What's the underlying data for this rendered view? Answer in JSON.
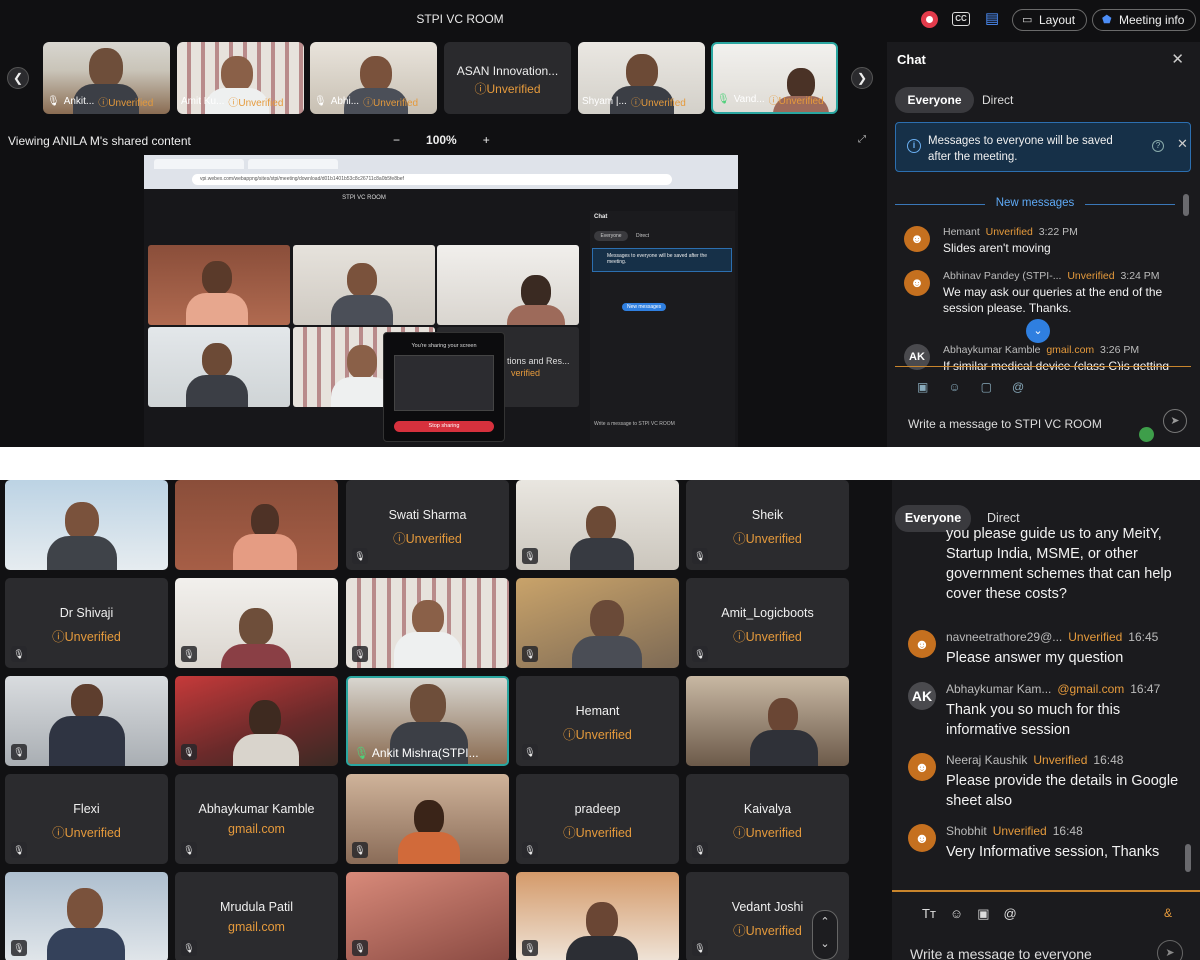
{
  "top": {
    "room_title": "STPI VC ROOM",
    "header": {
      "layout_label": "Layout",
      "meeting_info_label": "Meeting info"
    },
    "strip": [
      {
        "name": "Ankit...",
        "status": "Unverified"
      },
      {
        "name": "Amit Ku...",
        "status": "Unverified"
      },
      {
        "name": "Abhi...",
        "status": "Unverified"
      },
      {
        "name": "ASAN Innovation...",
        "status": "Unverified"
      },
      {
        "name": "Shyam |...",
        "status": "Unverified"
      },
      {
        "name": "Vand...",
        "status": "Unverified"
      }
    ],
    "viewing_label": "Viewing ANILA M's shared content",
    "zoom": {
      "minus": "−",
      "value": "100%",
      "plus": "+"
    },
    "shared": {
      "inner_title": "STPI VC ROOM",
      "url": "vpi.webex.com/webappng/sites/stpi/meeting/download/d01b1401b53c8c26711c8a0b5fe8bef",
      "chat_title": "Chat",
      "chat_tabs": [
        "Everyone",
        "Direct"
      ],
      "notice": "Messages to everyone will be saved after the meeting.",
      "new_messages": "New messages",
      "tile_text": "tions and Res...",
      "tile_status": "verified",
      "sharing_title": "You're sharing your screen",
      "stop_label": "Stop sharing",
      "write_label": "Write a message to STPI VC ROOM"
    },
    "chat": {
      "title": "Chat",
      "tabs": {
        "everyone": "Everyone",
        "direct": "Direct"
      },
      "notice": "Messages to everyone will be saved after the meeting.",
      "new_messages": "New messages",
      "messages": [
        {
          "sender": "Hemant",
          "status": "Unverified",
          "time": "3:22 PM",
          "text": "Slides aren't moving"
        },
        {
          "sender": "Abhinav Pandey (STPI-...",
          "status": "Unverified",
          "time": "3:24 PM",
          "text": "We may ask our queries at the end of the session please. Thanks."
        },
        {
          "sender": "Abhaykumar Kamble",
          "status": "gmail.com",
          "time": "3:26 PM",
          "text": "If similar medical device (class C)is getting",
          "avatar": "AK"
        }
      ],
      "input_placeholder": "Write a message to STPI VC ROOM"
    }
  },
  "bottom": {
    "grid": [
      {
        "name": "",
        "status": ""
      },
      {
        "name": "",
        "status": ""
      },
      {
        "name": "Swati Sharma",
        "status": "Unverified"
      },
      {
        "name": "",
        "status": ""
      },
      {
        "name": "Sheik",
        "status": "Unverified"
      },
      {
        "name": "Dr Shivaji",
        "status": "Unverified"
      },
      {
        "name": "",
        "status": ""
      },
      {
        "name": "",
        "status": ""
      },
      {
        "name": "",
        "status": ""
      },
      {
        "name": "Amit_Logicboots",
        "status": "Unverified"
      },
      {
        "name": "",
        "status": ""
      },
      {
        "name": "",
        "status": ""
      },
      {
        "name": "Ankit Mishra(STPI...",
        "status": ""
      },
      {
        "name": "Hemant",
        "status": "Unverified"
      },
      {
        "name": "",
        "status": ""
      },
      {
        "name": "Flexi",
        "status": "Unverified"
      },
      {
        "name": "Abhaykumar Kamble",
        "status": "gmail.com"
      },
      {
        "name": "",
        "status": ""
      },
      {
        "name": "pradeep",
        "status": "Unverified"
      },
      {
        "name": "Kaivalya",
        "status": "Unverified"
      },
      {
        "name": "",
        "status": ""
      },
      {
        "name": "Mrudula Patil",
        "status": "gmail.com"
      },
      {
        "name": "",
        "status": ""
      },
      {
        "name": "",
        "status": ""
      },
      {
        "name": "Vedant Joshi",
        "status": "Unverified"
      }
    ],
    "chat": {
      "tabs": {
        "everyone": "Everyone",
        "direct": "Direct"
      },
      "continued_text": "you please guide us to any MeitY, Startup India, MSME, or other government schemes that can help cover these costs?",
      "messages": [
        {
          "sender": "navneetrathore29@...",
          "status": "Unverified",
          "time": "16:45",
          "text": "Please answer my question"
        },
        {
          "sender": "Abhaykumar Kam...",
          "status": "@gmail.com",
          "time": "16:47",
          "text": "Thank you so much for this informative session",
          "avatar": "AK"
        },
        {
          "sender": "Neeraj Kaushik",
          "status": "Unverified",
          "time": "16:48",
          "text": "Please provide the details in Google sheet also"
        },
        {
          "sender": "Shobhit",
          "status": "Unverified",
          "time": "16:48",
          "text": "Very Informative session, Thanks"
        }
      ],
      "input_placeholder": "Write a message to everyone"
    }
  }
}
